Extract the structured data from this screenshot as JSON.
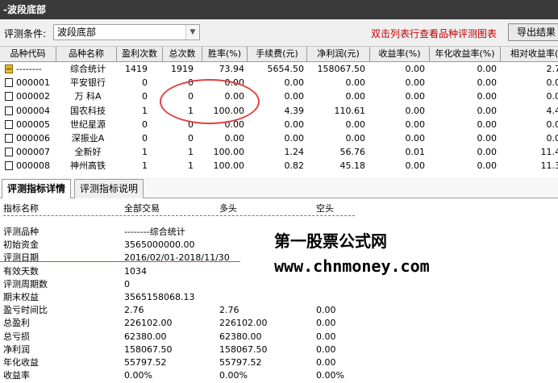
{
  "window": {
    "title": "-波段底部"
  },
  "condition": {
    "label": "评测条件:",
    "selected": "波段底部",
    "hint": "双击列表行查看品种评测图表",
    "export_label": "导出结果"
  },
  "grid": {
    "headers": [
      "品种代码",
      "品种名称",
      "盈利次数",
      "总次数",
      "胜率(%)",
      "手续费(元)",
      "净利润(元)",
      "收益率(%)",
      "年化收益率(%)",
      "相对收益率(%)"
    ],
    "rows": [
      {
        "code": "--------",
        "name": "综合统计",
        "wins": "1419",
        "total": "1919",
        "winrate": "73.94",
        "fee": "5654.50",
        "profit": "158067.50",
        "ret": "0.00",
        "annual": "0.00",
        "relative": "2.7"
      },
      {
        "code": "000001",
        "name": "平安银行",
        "wins": "0",
        "total": "0",
        "winrate": "0.00",
        "fee": "0.00",
        "profit": "0.00",
        "ret": "0.00",
        "annual": "0.00",
        "relative": "0.0"
      },
      {
        "code": "000002",
        "name": "万 科A",
        "wins": "0",
        "total": "0",
        "winrate": "0.00",
        "fee": "0.00",
        "profit": "0.00",
        "ret": "0.00",
        "annual": "0.00",
        "relative": "0.0"
      },
      {
        "code": "000004",
        "name": "国农科技",
        "wins": "1",
        "total": "1",
        "winrate": "100.00",
        "fee": "4.39",
        "profit": "110.61",
        "ret": "0.00",
        "annual": "0.00",
        "relative": "4.4"
      },
      {
        "code": "000005",
        "name": "世纪星源",
        "wins": "0",
        "total": "0",
        "winrate": "0.00",
        "fee": "0.00",
        "profit": "0.00",
        "ret": "0.00",
        "annual": "0.00",
        "relative": "0.0"
      },
      {
        "code": "000006",
        "name": "深振业A",
        "wins": "0",
        "total": "0",
        "winrate": "0.00",
        "fee": "0.00",
        "profit": "0.00",
        "ret": "0.00",
        "annual": "0.00",
        "relative": "0.0"
      },
      {
        "code": "000007",
        "name": "全新好",
        "wins": "1",
        "total": "1",
        "winrate": "100.00",
        "fee": "1.24",
        "profit": "56.76",
        "ret": "0.01",
        "annual": "0.00",
        "relative": "11.4"
      },
      {
        "code": "000008",
        "name": "神州高铁",
        "wins": "1",
        "total": "1",
        "winrate": "100.00",
        "fee": "0.82",
        "profit": "45.18",
        "ret": "0.00",
        "annual": "0.00",
        "relative": "11.3"
      }
    ]
  },
  "tabs": [
    {
      "label": "评测指标详情",
      "active": true
    },
    {
      "label": "评测指标说明",
      "active": false
    }
  ],
  "detail": {
    "headers": [
      "指标名称",
      "全部交易",
      "多头",
      "空头"
    ],
    "rows": [
      {
        "name": "评测品种",
        "all": "--------综合统计",
        "long": "",
        "short": ""
      },
      {
        "name": "初始资金",
        "all": "3565000000.00",
        "long": "",
        "short": ""
      },
      {
        "name": "评测日期",
        "all": "2016/02/01-2018/11/30",
        "long": "",
        "short": ""
      },
      {
        "name": "有效天数",
        "all": "1034",
        "long": "",
        "short": ""
      },
      {
        "name": "评测周期数",
        "all": "0",
        "long": "",
        "short": ""
      },
      {
        "name": "期末权益",
        "all": "3565158068.13",
        "long": "",
        "short": ""
      },
      {
        "name": "盈亏时间比",
        "all": "2.76",
        "long": "2.76",
        "short": "0.00"
      },
      {
        "name": "总盈利",
        "all": "226102.00",
        "long": "226102.00",
        "short": "0.00"
      },
      {
        "name": "总亏损",
        "all": "62380.00",
        "long": "62380.00",
        "short": "0.00"
      },
      {
        "name": "净利润",
        "all": "158067.50",
        "long": "158067.50",
        "short": "0.00"
      },
      {
        "name": "年化收益",
        "all": "55797.52",
        "long": "55797.52",
        "short": "0.00"
      },
      {
        "name": "收益率",
        "all": "0.00%",
        "long": "0.00%",
        "short": "0.00%"
      }
    ]
  },
  "watermark": {
    "line1": "第一股票公式网",
    "line2": "www.chnmoney.com"
  },
  "colors": {
    "titlebar": "#3a3a3a",
    "hint": "#c00000",
    "annotation": "#e04040"
  }
}
